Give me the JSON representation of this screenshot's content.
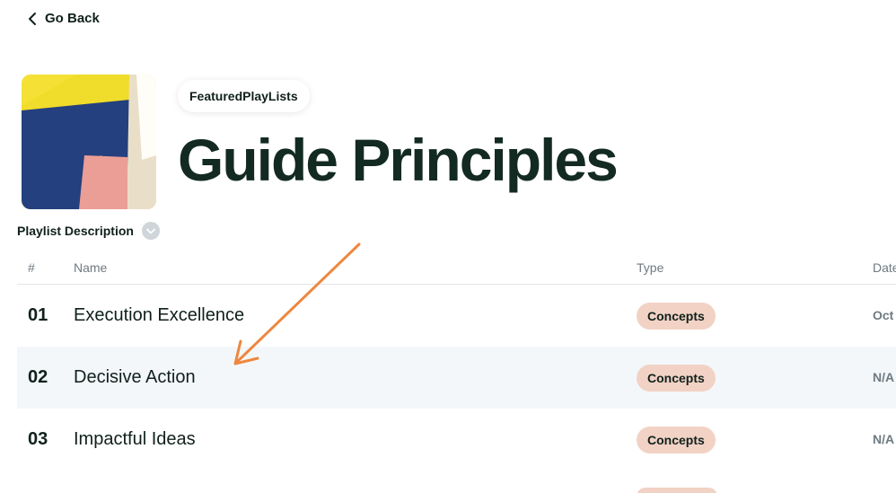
{
  "nav": {
    "back_label": "Go Back"
  },
  "playlist": {
    "tag": "FeaturedPlayLists",
    "title": "Guide Principles",
    "description_label": "Playlist Description"
  },
  "table": {
    "headers": {
      "num": "#",
      "name": "Name",
      "type": "Type",
      "date": "Date"
    },
    "rows": [
      {
        "num": "01",
        "name": "Execution Excellence",
        "type": "Concepts",
        "date": "Oct"
      },
      {
        "num": "02",
        "name": "Decisive Action",
        "type": "Concepts",
        "date": "N/A"
      },
      {
        "num": "03",
        "name": "Impactful Ideas",
        "type": "Concepts",
        "date": "N/A"
      }
    ]
  },
  "colors": {
    "title": "#132a22",
    "badge_bg": "#f1d2c5",
    "row_highlight": "#f3f7fa",
    "annotation_arrow": "#ee8740"
  },
  "icons": {
    "back": "chevron-left-icon",
    "description": "chevron-down-icon"
  }
}
